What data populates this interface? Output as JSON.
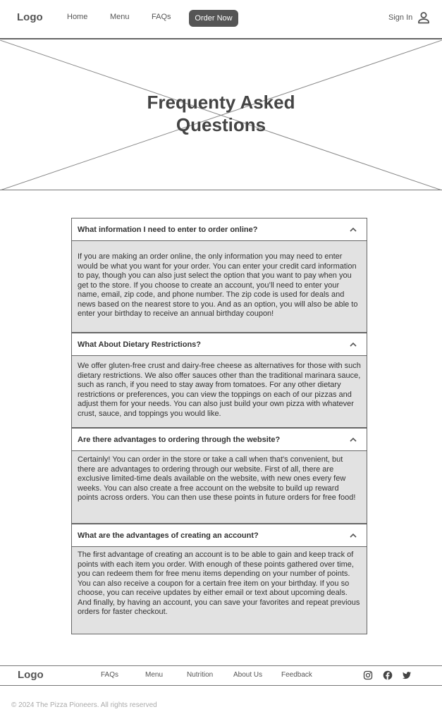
{
  "header": {
    "logo": "Logo",
    "nav": [
      "Home",
      "Menu",
      "FAQs"
    ],
    "order_button": "Order Now",
    "sign_in": "Sign In",
    "user_icon": "person-icon"
  },
  "hero": {
    "title_line1": "Frequenty Asked",
    "title_line2": "Questions"
  },
  "faq": [
    {
      "question": "What information I need to enter to order online?",
      "answer": "If you are making an order online, the only information you may need to enter would be what you want for your order. You can enter your credit card information to pay, though you can also just select the option that you want to pay when you get to the store. If you choose to create an account, you’ll need to enter your name, email, zip code, and phone number. The zip code is used for deals and news based on the nearest store to you. And as an option, you will also be able to enter your birthday to receive an annual birthday coupon!"
    },
    {
      "question": "What About Dietary Restrictions?",
      "answer": "We offer gluten-free crust and dairy-free cheese as alternatives for those with such dietary restrictions. We also offer sauces other than the traditional marinara sauce, such as ranch, if you need to stay away from tomatoes. For any other dietary restrictions or preferences, you can view the toppings on each of our pizzas and adjust them for your needs. You can also just build your own pizza with whatever crust, sauce, and toppings you would like."
    },
    {
      "question": "Are there advantages to ordering through the website?",
      "answer": "Certainly! You can order in the store or take a call when that's convenient, but there are advantages to ordering through our website. First of all, there are exclusive limited-time deals available on the website, with new ones every few weeks. You can also create a free account on the website to build up reward points across orders. You can then use these points in future orders for free food!"
    },
    {
      "question": "What are the advantages of creating an account?",
      "answer": "The first advantage of creating an account is to be able to gain and keep track of points with each item you order. With enough of these points gathered over time, you can redeem them for free menu items depending on your number of points. You can also receive a coupon for a certain free item on your birthday. If you so choose, you can receive updates by either email or text about upcoming deals. And finally, by having an account, you can save your favorites and repeat previous orders for faster checkout."
    }
  ],
  "footer": {
    "logo": "Logo",
    "links": [
      "FAQs",
      "Menu",
      "Nutrition",
      "About Us",
      "Feedback"
    ],
    "social_icons": [
      "instagram-icon",
      "facebook-icon",
      "twitter-icon"
    ],
    "copyright": "© 2024 The Pizza Pioneers. All rights reserved"
  },
  "colors": {
    "accent": "#555555",
    "answer_background": "#e2e2e2",
    "border": "#666666"
  }
}
